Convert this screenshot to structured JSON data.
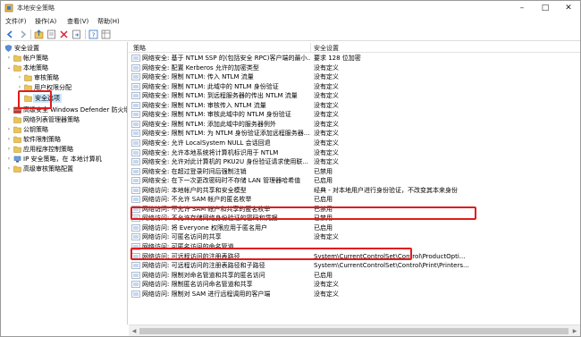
{
  "window": {
    "title": "本地安全策略"
  },
  "menu": [
    "文件(F)",
    "操作(A)",
    "查看(V)",
    "帮助(H)"
  ],
  "tree": {
    "root": "安全设置",
    "account": "帐户策略",
    "local": "本地策略",
    "audit": "审核策略",
    "rights": "用户权限分配",
    "secopts": "安全选项",
    "defender": "高级安全 Windows Defender 防火墙",
    "netlist": "网络列表管理器策略",
    "pubkey": "公钥策略",
    "software": "软件限制策略",
    "applocker": "应用程序控制策略",
    "ipsec": "IP 安全策略，在 本地计算机",
    "auditcfg": "高级审核策略配置"
  },
  "list": {
    "col_policy": "策略",
    "col_setting": "安全设置",
    "rows": [
      {
        "name": "网络安全: 基于 NTLM SSP 的(包括安全 RPC)客户端的最小...",
        "value": "要求 128 位加密"
      },
      {
        "name": "网络安全: 配置 Kerberos 允许的加密类型",
        "value": "没有定义"
      },
      {
        "name": "网络安全: 限制 NTLM: 传入 NTLM 流量",
        "value": "没有定义"
      },
      {
        "name": "网络安全: 限制 NTLM: 此域中的 NTLM 身份验证",
        "value": "没有定义"
      },
      {
        "name": "网络安全: 限制 NTLM: 到远程服务器的传出 NTLM 流量",
        "value": "没有定义"
      },
      {
        "name": "网络安全: 限制 NTLM: 审核传入 NTLM 流量",
        "value": "没有定义"
      },
      {
        "name": "网络安全: 限制 NTLM: 审核此域中的 NTLM 身份验证",
        "value": "没有定义"
      },
      {
        "name": "网络安全: 限制 NTLM: 添加此域中的服务器例外",
        "value": "没有定义"
      },
      {
        "name": "网络安全: 限制 NTLM: 为 NTLM 身份验证添加远程服务器...",
        "value": "没有定义"
      },
      {
        "name": "网络安全: 允许 LocalSystem NULL 会话回退",
        "value": "没有定义"
      },
      {
        "name": "网络安全: 允许本地系统将计算机标识用于 NTLM",
        "value": "没有定义"
      },
      {
        "name": "网络安全: 允许对此计算机的 PKU2U 身份验证请求使用联...",
        "value": "没有定义"
      },
      {
        "name": "网络安全: 在超过登录时间后强制注销",
        "value": "已禁用"
      },
      {
        "name": "网络安全: 在下一次更改密码时不存储 LAN 管理器哈希值",
        "value": "已启用"
      },
      {
        "name": "网络访问: 本地帐户的共享和安全模型",
        "value": "经典 - 对本地用户进行身份验证，不改变其本来身份"
      },
      {
        "name": "网络访问: 不允许 SAM 帐户的匿名枚举",
        "value": "已启用"
      },
      {
        "name": "网络访问: 不允许 SAM 帐户和共享的匿名枚举",
        "value": "已禁用"
      },
      {
        "name": "网络访问: 不允许存储网络身份验证的密码和凭据",
        "value": "已禁用"
      },
      {
        "name": "网络访问: 将 Everyone 权限应用于匿名用户",
        "value": "已启用"
      },
      {
        "name": "网络访问: 可匿名访问的共享",
        "value": "没有定义"
      },
      {
        "name": "网络访问: 可匿名访问的命名管道",
        "value": ""
      },
      {
        "name": "网络访问: 可远程访问的注册表路径",
        "value": "System\\CurrentControlSet\\Control\\ProductOpti..."
      },
      {
        "name": "网络访问: 可远程访问的注册表路径和子路径",
        "value": "System\\CurrentControlSet\\Control\\Print\\Printers..."
      },
      {
        "name": "网络访问: 限制对命名管道和共享的匿名访问",
        "value": "已启用"
      },
      {
        "name": "网络访问: 限制匿名访问命名管道和共享",
        "value": "没有定义"
      },
      {
        "name": "网络访问: 限制对 SAM 进行远程调用的客户端",
        "value": "没有定义"
      }
    ]
  },
  "colors": {
    "highlight_box": "#e21b1b",
    "selected_bg": "#cce8ff"
  },
  "icons": [
    "app-icon",
    "back-icon",
    "forward-icon",
    "up-icon",
    "properties-icon",
    "delete-icon",
    "export-icon",
    "help-icon",
    "grid-icon",
    "folder-icon",
    "policy-row-icon"
  ]
}
